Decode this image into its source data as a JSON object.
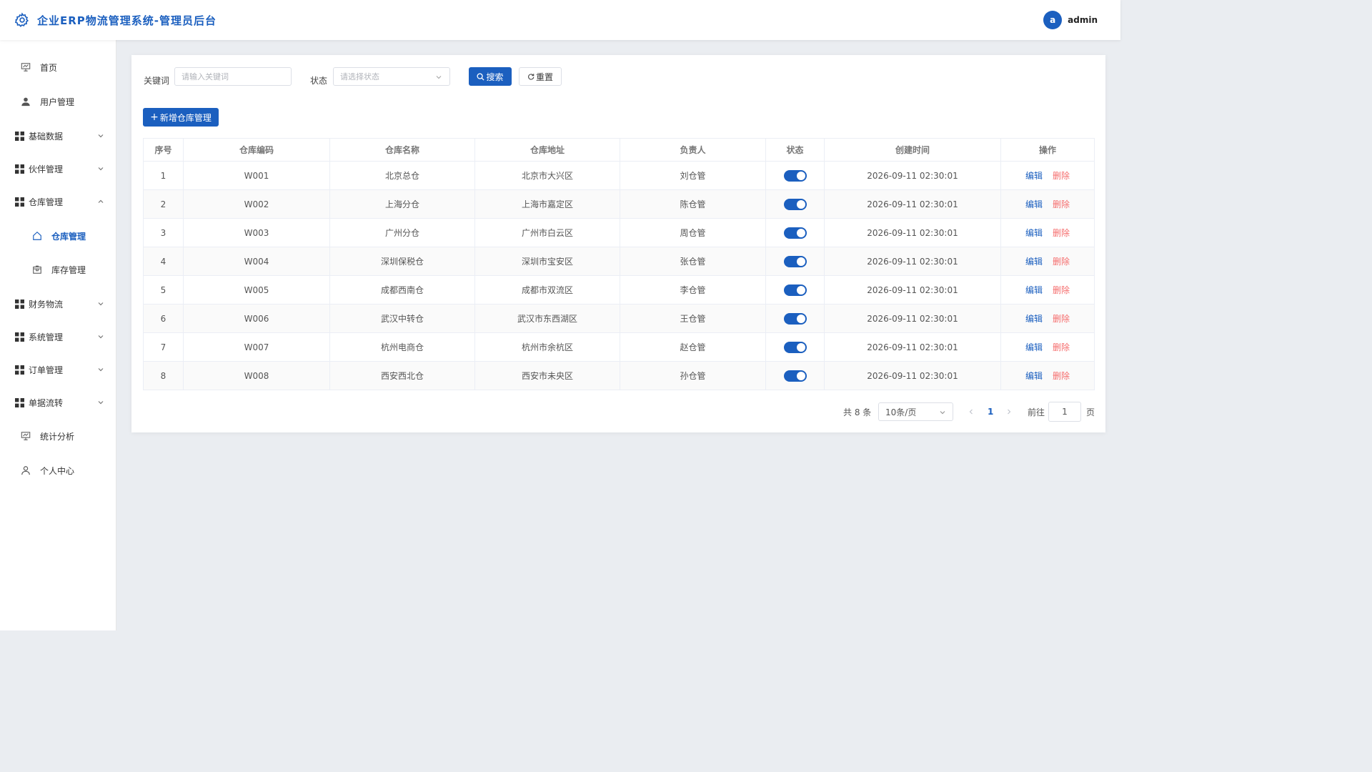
{
  "header": {
    "title": "企业ERP物流管理系统-管理员后台",
    "user_initial": "a",
    "username": "admin"
  },
  "sidebar": {
    "items": [
      {
        "label": "首页",
        "icon": "presentation-icon"
      },
      {
        "label": "用户管理",
        "icon": "user-icon"
      },
      {
        "label": "基础数据",
        "icon": "grid-icon"
      },
      {
        "label": "伙伴管理",
        "icon": "grid-icon"
      },
      {
        "label": "仓库管理",
        "icon": "grid-icon"
      },
      {
        "label": "仓库管理",
        "icon": "home-icon"
      },
      {
        "label": "库存管理",
        "icon": "box-icon"
      },
      {
        "label": "财务物流",
        "icon": "grid-icon"
      },
      {
        "label": "系统管理",
        "icon": "grid-icon"
      },
      {
        "label": "订单管理",
        "icon": "grid-icon"
      },
      {
        "label": "单据流转",
        "icon": "grid-icon"
      },
      {
        "label": "统计分析",
        "icon": "presentation-icon"
      },
      {
        "label": "个人中心",
        "icon": "person-icon"
      }
    ]
  },
  "filters": {
    "keyword_label": "关键词",
    "keyword_placeholder": "请输入关键词",
    "status_label": "状态",
    "status_placeholder": "请选择状态",
    "search_label": "搜索",
    "reset_label": "重置"
  },
  "add_button_label": "新增仓库管理",
  "table": {
    "columns": [
      "序号",
      "仓库编码",
      "仓库名称",
      "仓库地址",
      "负责人",
      "状态",
      "创建时间",
      "操作"
    ],
    "edit_label": "编辑",
    "delete_label": "删除",
    "rows": [
      {
        "no": "1",
        "code": "W001",
        "name": "北京总仓",
        "address": "北京市大兴区",
        "manager": "刘仓管",
        "enabled": true,
        "created": "2026-09-11 02:30:01"
      },
      {
        "no": "2",
        "code": "W002",
        "name": "上海分仓",
        "address": "上海市嘉定区",
        "manager": "陈仓管",
        "enabled": true,
        "created": "2026-09-11 02:30:01"
      },
      {
        "no": "3",
        "code": "W003",
        "name": "广州分仓",
        "address": "广州市白云区",
        "manager": "周仓管",
        "enabled": true,
        "created": "2026-09-11 02:30:01"
      },
      {
        "no": "4",
        "code": "W004",
        "name": "深圳保税仓",
        "address": "深圳市宝安区",
        "manager": "张仓管",
        "enabled": true,
        "created": "2026-09-11 02:30:01"
      },
      {
        "no": "5",
        "code": "W005",
        "name": "成都西南仓",
        "address": "成都市双流区",
        "manager": "李仓管",
        "enabled": true,
        "created": "2026-09-11 02:30:01"
      },
      {
        "no": "6",
        "code": "W006",
        "name": "武汉中转仓",
        "address": "武汉市东西湖区",
        "manager": "王仓管",
        "enabled": true,
        "created": "2026-09-11 02:30:01"
      },
      {
        "no": "7",
        "code": "W007",
        "name": "杭州电商仓",
        "address": "杭州市余杭区",
        "manager": "赵仓管",
        "enabled": true,
        "created": "2026-09-11 02:30:01"
      },
      {
        "no": "8",
        "code": "W008",
        "name": "西安西北仓",
        "address": "西安市未央区",
        "manager": "孙仓管",
        "enabled": true,
        "created": "2026-09-11 02:30:01"
      }
    ]
  },
  "pagination": {
    "total_text": "共 8 条",
    "page_size": "10条/页",
    "current_page": "1",
    "goto_prefix": "前往",
    "goto_value": "1",
    "goto_suffix": "页"
  },
  "colors": {
    "accent": "#1b5fbf",
    "danger": "#f56c6c",
    "background": "#eaedf1"
  }
}
